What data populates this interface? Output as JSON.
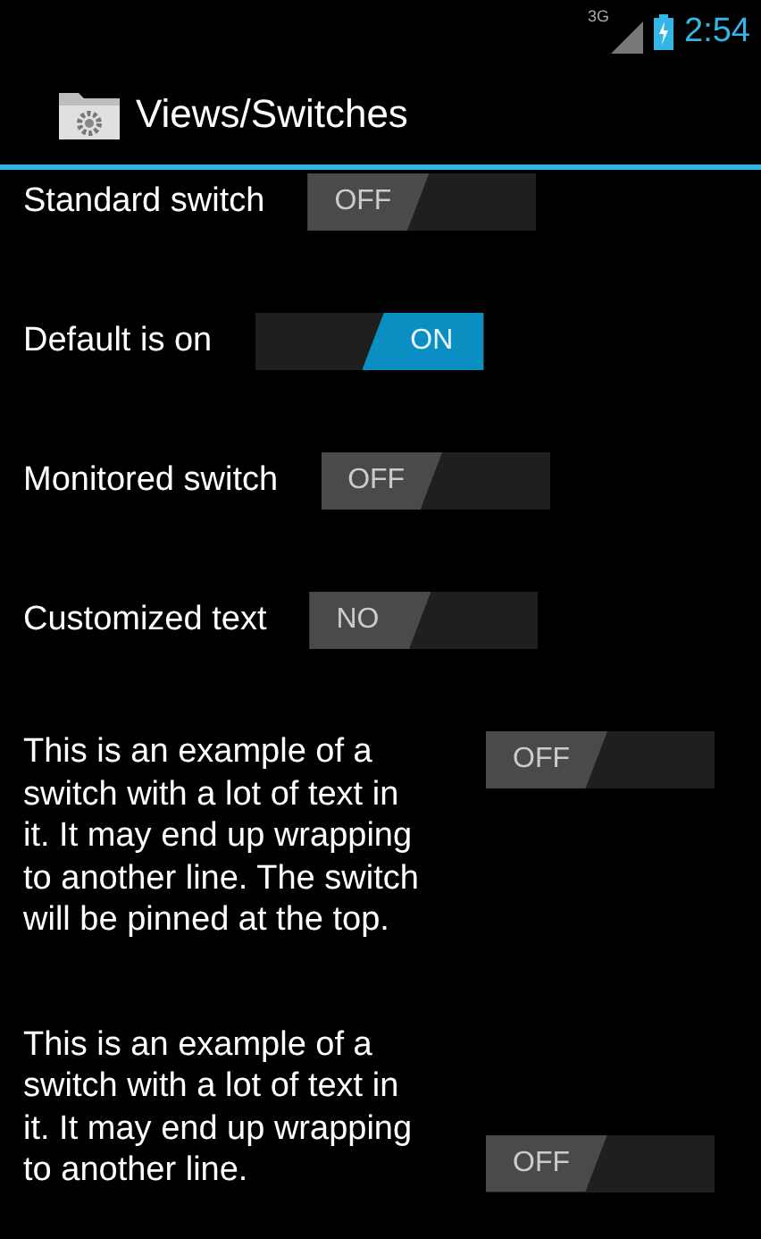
{
  "status_bar": {
    "network": "3G",
    "time": "2:54"
  },
  "action_bar": {
    "title": "Views/Switches"
  },
  "switches": [
    {
      "label": "Standard switch",
      "on": false,
      "state_text": "OFF",
      "kind": "inline"
    },
    {
      "label": "Default is on",
      "on": true,
      "state_text": "ON",
      "kind": "inline"
    },
    {
      "label": "Monitored switch",
      "on": false,
      "state_text": "OFF",
      "kind": "inline"
    },
    {
      "label": "Customized text",
      "on": false,
      "state_text": "NO",
      "kind": "inline"
    },
    {
      "label": "This is an example of a switch with a lot of text in it. It may end up wrapping to another line. The switch will be pinned at the top.",
      "on": false,
      "state_text": "OFF",
      "kind": "top"
    },
    {
      "label": "This is an example of a switch with a lot of text in it. It may end up wrapping to another line.",
      "on": false,
      "state_text": "OFF",
      "kind": "bottom"
    }
  ]
}
